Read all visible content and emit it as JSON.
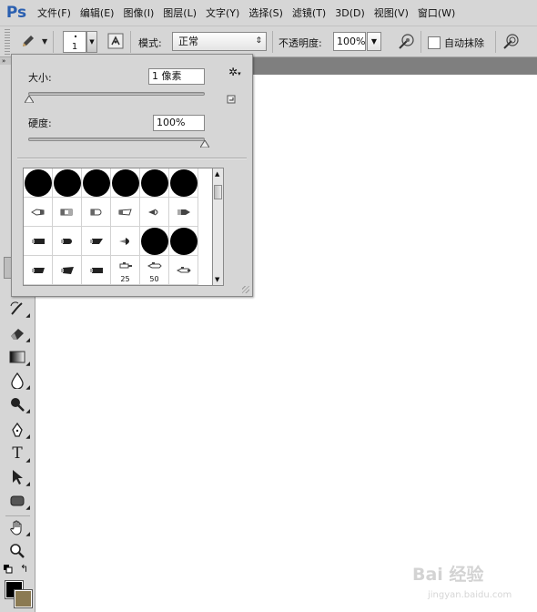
{
  "app": {
    "logo": "Ps"
  },
  "menubar": {
    "items": [
      "文件(F)",
      "编辑(E)",
      "图像(I)",
      "图层(L)",
      "文字(Y)",
      "选择(S)",
      "滤镜(T)",
      "3D(D)",
      "视图(V)",
      "窗口(W)"
    ]
  },
  "options_bar": {
    "brush_size": "1",
    "mode_label": "模式:",
    "mode_value": "正常",
    "opacity_label": "不透明度:",
    "opacity_value": "100%",
    "auto_erase_label": "自动抹除",
    "auto_erase_checked": false
  },
  "brush_panel": {
    "size_label": "大小:",
    "size_value": "1 像素",
    "size_level": 0.0,
    "hardness_label": "硬度:",
    "hardness_value": "100%",
    "hardness_level": 1.0,
    "preset_numbers": {
      "c4_4": "25",
      "c4_5": "50"
    }
  },
  "watermark": {
    "text": "Bai 经验",
    "sub": "jingyan.baidu.com"
  },
  "colors": {
    "foreground": "#000000",
    "background": "#8b7a52",
    "accent": "#2a5fb0"
  }
}
